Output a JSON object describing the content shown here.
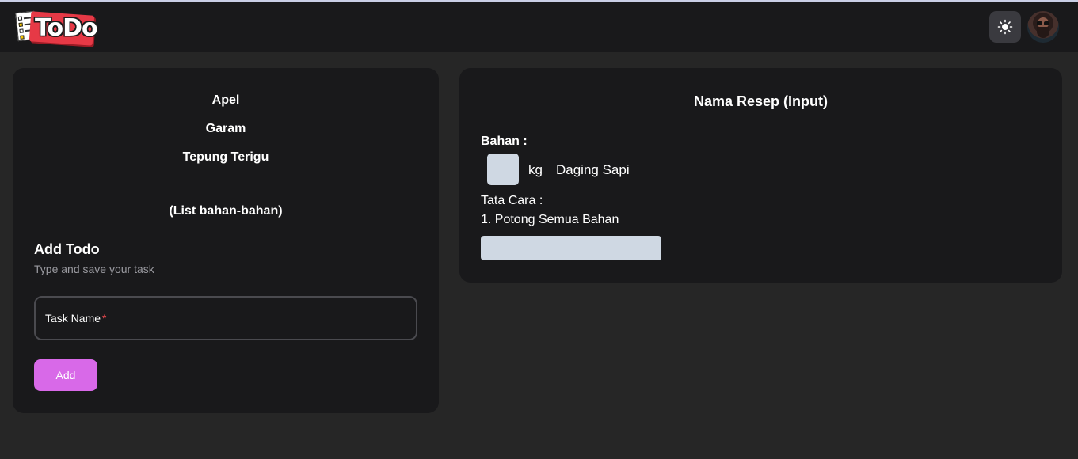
{
  "app": {
    "logo_text": "ToDo",
    "theme_toggle_icon": "sun-icon",
    "avatar_icon": "user-avatar"
  },
  "ingredients_list": {
    "items": [
      "Apel",
      "Garam",
      "Tepung Terigu"
    ],
    "caption": "(List bahan-bahan)"
  },
  "add_todo": {
    "title": "Add Todo",
    "subtitle": "Type and save your task",
    "task_label": "Task Name",
    "required_mark": "*",
    "add_label": "Add"
  },
  "recipe": {
    "title": "Nama Resep (Input)",
    "bahan_label": "Bahan :",
    "unit": "kg",
    "ingredient_name": "Daging Sapi",
    "tata_cara_label": "Tata Cara :",
    "step_text": "1. Potong Semua Bahan"
  },
  "colors": {
    "background": "#262626",
    "card": "#19191b",
    "accent_button": "#d869e8",
    "input_fill": "#cfd8e3"
  }
}
